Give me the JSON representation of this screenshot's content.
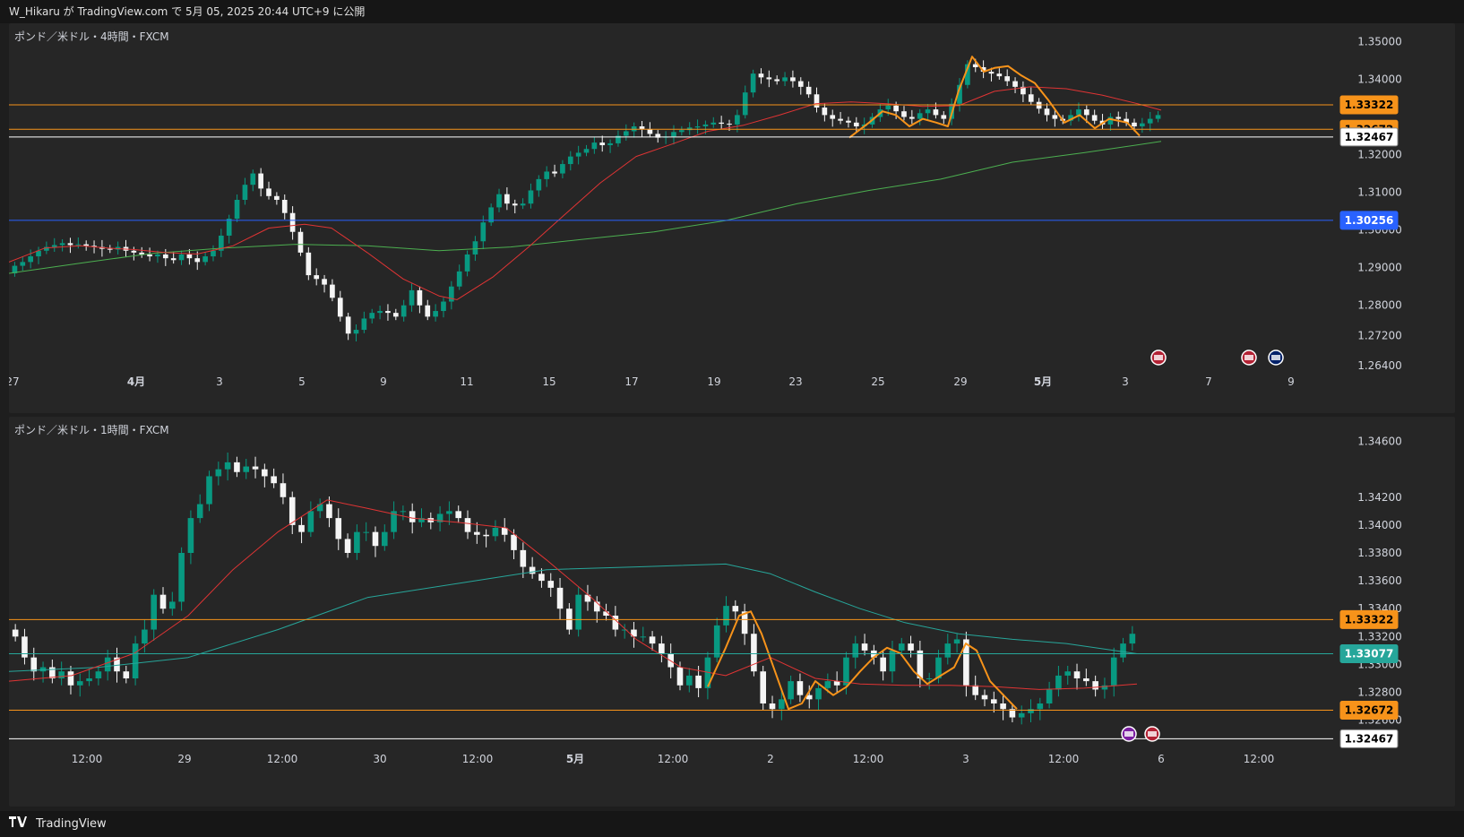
{
  "header": {
    "title": "W_Hikaru が TradingView.com で 5月 05, 2025 20:44 UTC+9 に公開"
  },
  "footer": {
    "brand": "TradingView"
  },
  "colors": {
    "up": "#089981",
    "down": "#f5f5f5",
    "orange": "#f7931a",
    "ma_red": "#e03434",
    "ma_green": "#4caf50",
    "ma_teal": "#26a69a",
    "blue_line": "#2962ff",
    "white_line": "#ffffff"
  },
  "chart_data": [
    {
      "type": "candlestick",
      "title": "ポンド／米ドル・4時間・FXCM",
      "y_ticks": [
        "1.35000",
        "1.34000",
        "1.32000",
        "1.31000",
        "1.30000",
        "1.29000",
        "1.28000",
        "1.27200",
        "1.26400"
      ],
      "y_tick_values": [
        1.35,
        1.34,
        1.32,
        1.31,
        1.3,
        1.29,
        1.28,
        1.272,
        1.264
      ],
      "ylim": [
        1.264,
        1.352
      ],
      "x_ticks": [
        "27",
        "4月",
        "3",
        "5",
        "9",
        "11",
        "15",
        "17",
        "19",
        "23",
        "25",
        "29",
        "5月",
        "3",
        "7",
        "9"
      ],
      "x_tick_bold": [
        false,
        true,
        false,
        false,
        false,
        false,
        false,
        false,
        false,
        false,
        false,
        false,
        true,
        false,
        false,
        false
      ],
      "close_series": [
        1.2905,
        1.2915,
        1.293,
        1.2945,
        1.2955,
        1.296,
        1.2965,
        1.296,
        1.2962,
        1.2958,
        1.2955,
        1.295,
        1.2948,
        1.2955,
        1.2945,
        1.294,
        1.2935,
        1.293,
        1.2935,
        1.2925,
        1.292,
        1.2935,
        1.2925,
        1.2915,
        1.293,
        1.2945,
        1.2985,
        1.303,
        1.308,
        1.312,
        1.315,
        1.311,
        1.309,
        1.308,
        1.3045,
        1.2995,
        1.294,
        1.288,
        1.287,
        1.2855,
        1.282,
        1.277,
        1.2725,
        1.2735,
        1.2765,
        1.278,
        1.2785,
        1.278,
        1.277,
        1.28,
        1.284,
        1.28,
        1.277,
        1.2785,
        1.281,
        1.285,
        1.289,
        1.2935,
        1.297,
        1.302,
        1.306,
        1.3095,
        1.307,
        1.3065,
        1.307,
        1.3105,
        1.3135,
        1.3155,
        1.315,
        1.3175,
        1.3195,
        1.3205,
        1.3215,
        1.3232,
        1.3225,
        1.323,
        1.325,
        1.3262,
        1.3275,
        1.3268,
        1.3255,
        1.3245,
        1.3248,
        1.326,
        1.3265,
        1.3272,
        1.3275,
        1.328,
        1.3285,
        1.3282,
        1.328,
        1.3305,
        1.3365,
        1.3415,
        1.3405,
        1.34,
        1.3395,
        1.3405,
        1.3395,
        1.338,
        1.336,
        1.3325,
        1.3305,
        1.3295,
        1.329,
        1.3285,
        1.3275,
        1.328,
        1.33,
        1.332,
        1.333,
        1.3315,
        1.33,
        1.3295,
        1.331,
        1.332,
        1.3305,
        1.3295,
        1.3335,
        1.3385,
        1.344,
        1.3432,
        1.342,
        1.3415,
        1.3408,
        1.3395,
        1.338,
        1.336,
        1.334,
        1.3322,
        1.3305,
        1.3295,
        1.329,
        1.3305,
        1.332,
        1.3305,
        1.329,
        1.328,
        1.33,
        1.3295,
        1.3285,
        1.3275,
        1.3283,
        1.3295,
        1.3305
      ],
      "ma_red": [
        [
          0,
          1.2915
        ],
        [
          40,
          1.2952
        ],
        [
          80,
          1.2958
        ],
        [
          110,
          1.2952
        ],
        [
          140,
          1.2948
        ],
        [
          175,
          1.294
        ],
        [
          210,
          1.2936
        ],
        [
          250,
          1.2958
        ],
        [
          290,
          1.3005
        ],
        [
          330,
          1.3015
        ],
        [
          360,
          1.3005
        ],
        [
          400,
          1.294
        ],
        [
          440,
          1.287
        ],
        [
          480,
          1.2825
        ],
        [
          500,
          1.2815
        ],
        [
          540,
          1.2875
        ],
        [
          580,
          1.2955
        ],
        [
          620,
          1.304
        ],
        [
          660,
          1.3125
        ],
        [
          700,
          1.3195
        ],
        [
          740,
          1.3228
        ],
        [
          780,
          1.3262
        ],
        [
          820,
          1.3278
        ],
        [
          860,
          1.3305
        ],
        [
          900,
          1.3335
        ],
        [
          940,
          1.334
        ],
        [
          980,
          1.3335
        ],
        [
          1020,
          1.3328
        ],
        [
          1060,
          1.333
        ],
        [
          1100,
          1.3368
        ],
        [
          1140,
          1.338
        ],
        [
          1180,
          1.3375
        ],
        [
          1220,
          1.3358
        ],
        [
          1260,
          1.3335
        ],
        [
          1286,
          1.3318
        ]
      ],
      "ma_green": [
        [
          0,
          1.2885
        ],
        [
          80,
          1.2912
        ],
        [
          160,
          1.2938
        ],
        [
          240,
          1.2952
        ],
        [
          320,
          1.2962
        ],
        [
          400,
          1.2958
        ],
        [
          480,
          1.2945
        ],
        [
          560,
          1.2955
        ],
        [
          640,
          1.2975
        ],
        [
          720,
          1.2995
        ],
        [
          800,
          1.3025
        ],
        [
          880,
          1.307
        ],
        [
          960,
          1.3105
        ],
        [
          1040,
          1.3135
        ],
        [
          1120,
          1.318
        ],
        [
          1200,
          1.3205
        ],
        [
          1286,
          1.3235
        ]
      ],
      "zigzag_orange": [
        [
          938,
          1.3245
        ],
        [
          960,
          1.3285
        ],
        [
          975,
          1.3315
        ],
        [
          990,
          1.3305
        ],
        [
          1005,
          1.3275
        ],
        [
          1020,
          1.3295
        ],
        [
          1035,
          1.3285
        ],
        [
          1048,
          1.3275
        ],
        [
          1060,
          1.337
        ],
        [
          1075,
          1.346
        ],
        [
          1088,
          1.342
        ],
        [
          1100,
          1.343
        ],
        [
          1115,
          1.3435
        ],
        [
          1130,
          1.341
        ],
        [
          1145,
          1.339
        ],
        [
          1160,
          1.3345
        ],
        [
          1178,
          1.3285
        ],
        [
          1195,
          1.3305
        ],
        [
          1212,
          1.327
        ],
        [
          1228,
          1.3295
        ],
        [
          1248,
          1.3285
        ],
        [
          1262,
          1.325
        ]
      ],
      "h_lines": [
        {
          "value": 1.33322,
          "label": "1.33322",
          "color": "#f7931a"
        },
        {
          "value": 1.32672,
          "label": "1.32672",
          "color": "#f7931a"
        },
        {
          "value": 1.32467,
          "label": "1.32467",
          "color": "#ffffff"
        },
        {
          "value": 1.30256,
          "label": "1.30256",
          "color": "#2962ff"
        }
      ]
    },
    {
      "type": "candlestick",
      "title": "ポンド／米ドル・1時間・FXCM",
      "y_ticks": [
        "1.34600",
        "1.34200",
        "1.34000",
        "1.33800",
        "1.33600",
        "1.33400",
        "1.33200",
        "1.33000",
        "1.32800",
        "1.32600"
      ],
      "y_tick_values": [
        1.346,
        1.342,
        1.34,
        1.338,
        1.336,
        1.334,
        1.332,
        1.33,
        1.328,
        1.326
      ],
      "ylim": [
        1.3245,
        1.347
      ],
      "x_ticks": [
        "12:00",
        "29",
        "12:00",
        "30",
        "12:00",
        "5月",
        "12:00",
        "2",
        "12:00",
        "3",
        "12:00",
        "6",
        "12:00"
      ],
      "x_tick_bold": [
        false,
        false,
        false,
        false,
        false,
        true,
        false,
        false,
        false,
        false,
        false,
        false,
        false
      ],
      "close_series": [
        1.332,
        1.3305,
        1.3295,
        1.3298,
        1.329,
        1.3295,
        1.3285,
        1.3288,
        1.329,
        1.3295,
        1.3305,
        1.3295,
        1.329,
        1.3315,
        1.3325,
        1.335,
        1.334,
        1.3345,
        1.338,
        1.3405,
        1.3415,
        1.3435,
        1.344,
        1.3445,
        1.3438,
        1.3442,
        1.344,
        1.3435,
        1.343,
        1.342,
        1.34,
        1.3395,
        1.341,
        1.3415,
        1.3405,
        1.339,
        1.338,
        1.3395,
        1.3395,
        1.3385,
        1.3395,
        1.341,
        1.341,
        1.3402,
        1.3405,
        1.3402,
        1.3408,
        1.341,
        1.3405,
        1.3395,
        1.3393,
        1.3392,
        1.3398,
        1.3393,
        1.3382,
        1.337,
        1.3365,
        1.336,
        1.3355,
        1.334,
        1.3325,
        1.335,
        1.3345,
        1.3338,
        1.3335,
        1.3325,
        1.3325,
        1.332,
        1.332,
        1.3315,
        1.3308,
        1.3298,
        1.3285,
        1.3292,
        1.3283,
        1.3305,
        1.3328,
        1.3342,
        1.3338,
        1.3322,
        1.3295,
        1.3272,
        1.3268,
        1.3275,
        1.3288,
        1.3278,
        1.3275,
        1.3283,
        1.3288,
        1.3285,
        1.3305,
        1.3315,
        1.331,
        1.3305,
        1.3295,
        1.331,
        1.3315,
        1.331,
        1.329,
        1.329,
        1.3305,
        1.3315,
        1.3318,
        1.3285,
        1.3278,
        1.3275,
        1.3272,
        1.3268,
        1.3262,
        1.3265,
        1.3268,
        1.3272,
        1.3282,
        1.3292,
        1.3295,
        1.329,
        1.3288,
        1.3282,
        1.3285,
        1.3305,
        1.3315,
        1.3322
      ],
      "ma_red": [
        [
          0,
          1.3288
        ],
        [
          70,
          1.3292
        ],
        [
          140,
          1.3308
        ],
        [
          200,
          1.3335
        ],
        [
          250,
          1.3368
        ],
        [
          300,
          1.3395
        ],
        [
          355,
          1.3418
        ],
        [
          400,
          1.3412
        ],
        [
          450,
          1.3405
        ],
        [
          500,
          1.3402
        ],
        [
          555,
          1.3398
        ],
        [
          600,
          1.3375
        ],
        [
          650,
          1.3348
        ],
        [
          700,
          1.3318
        ],
        [
          750,
          1.3298
        ],
        [
          800,
          1.3292
        ],
        [
          850,
          1.3305
        ],
        [
          900,
          1.329
        ],
        [
          950,
          1.3286
        ],
        [
          1000,
          1.3285
        ],
        [
          1050,
          1.3285
        ],
        [
          1100,
          1.3284
        ],
        [
          1150,
          1.3282
        ],
        [
          1200,
          1.3283
        ],
        [
          1259,
          1.3286
        ]
      ],
      "ma_teal": [
        [
          0,
          1.3295
        ],
        [
          100,
          1.3298
        ],
        [
          200,
          1.3305
        ],
        [
          300,
          1.3325
        ],
        [
          400,
          1.3348
        ],
        [
          500,
          1.3358
        ],
        [
          600,
          1.3368
        ],
        [
          700,
          1.337
        ],
        [
          800,
          1.3372
        ],
        [
          850,
          1.3365
        ],
        [
          900,
          1.3352
        ],
        [
          950,
          1.334
        ],
        [
          1000,
          1.333
        ],
        [
          1060,
          1.3322
        ],
        [
          1120,
          1.3318
        ],
        [
          1180,
          1.3315
        ],
        [
          1259,
          1.33077
        ]
      ],
      "zigzag_orange": [
        [
          780,
          1.3284
        ],
        [
          800,
          1.3312
        ],
        [
          815,
          1.3335
        ],
        [
          828,
          1.3338
        ],
        [
          840,
          1.3322
        ],
        [
          855,
          1.3295
        ],
        [
          870,
          1.3268
        ],
        [
          885,
          1.3272
        ],
        [
          900,
          1.3288
        ],
        [
          920,
          1.3278
        ],
        [
          935,
          1.3284
        ],
        [
          950,
          1.3295
        ],
        [
          965,
          1.3305
        ],
        [
          980,
          1.3312
        ],
        [
          995,
          1.3308
        ],
        [
          1010,
          1.3295
        ],
        [
          1025,
          1.3286
        ],
        [
          1040,
          1.3292
        ],
        [
          1055,
          1.3298
        ],
        [
          1068,
          1.3315
        ],
        [
          1080,
          1.331
        ],
        [
          1095,
          1.3288
        ],
        [
          1110,
          1.3278
        ],
        [
          1125,
          1.3268
        ]
      ],
      "h_lines": [
        {
          "value": 1.33322,
          "label": "1.33322",
          "color": "#f7931a"
        },
        {
          "value": 1.33077,
          "label": "1.33077",
          "color": "#26a69a"
        },
        {
          "value": 1.32672,
          "label": "1.32672",
          "color": "#f7931a"
        },
        {
          "value": 1.32467,
          "label": "1.32467",
          "color": "#ffffff"
        }
      ]
    }
  ]
}
